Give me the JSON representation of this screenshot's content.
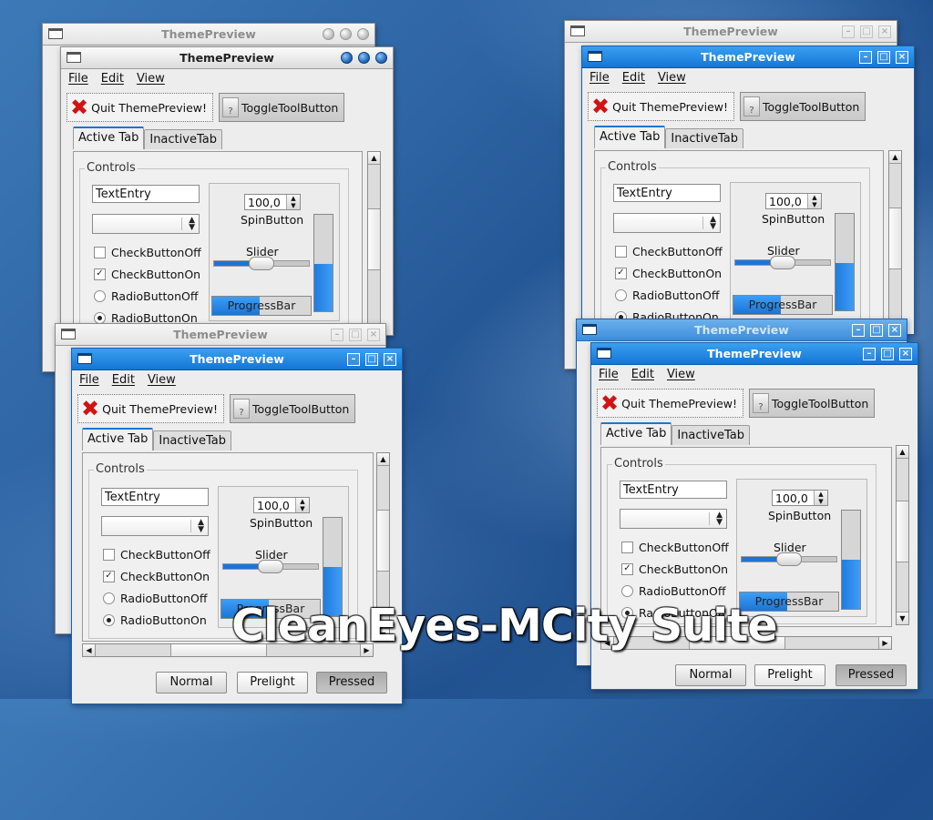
{
  "caption": "CleanEyes-MCity Suite",
  "window": {
    "title": "ThemePreview",
    "menu": [
      "File",
      "Edit",
      "View"
    ],
    "toolbar": {
      "quit_label": "Quit ThemePreview!",
      "toggle_label": "ToggleToolButton"
    },
    "tabs": {
      "active": "Active Tab",
      "inactive": "InactiveTab"
    },
    "controls": {
      "frame_label": "Controls",
      "text_entry_value": "TextEntry",
      "spin_value": "100,0",
      "spin_label": "SpinButton",
      "slider_label": "Slider",
      "progress_label": "ProgressBar",
      "checks": [
        {
          "label": "CheckButtonOff",
          "checked": false
        },
        {
          "label": "CheckButtonOn",
          "checked": true
        }
      ],
      "radios": [
        {
          "label": "RadioButtonOff",
          "selected": false
        },
        {
          "label": "RadioButtonOn",
          "selected": true
        }
      ]
    },
    "buttons": {
      "normal": "Normal",
      "prelight": "Prelight",
      "pressed": "Pressed"
    }
  },
  "colors": {
    "accent": "#1d74d4",
    "titlebar_active": "#1476d6",
    "desktop": "#2d63a2",
    "close_icon": "#d21313"
  }
}
